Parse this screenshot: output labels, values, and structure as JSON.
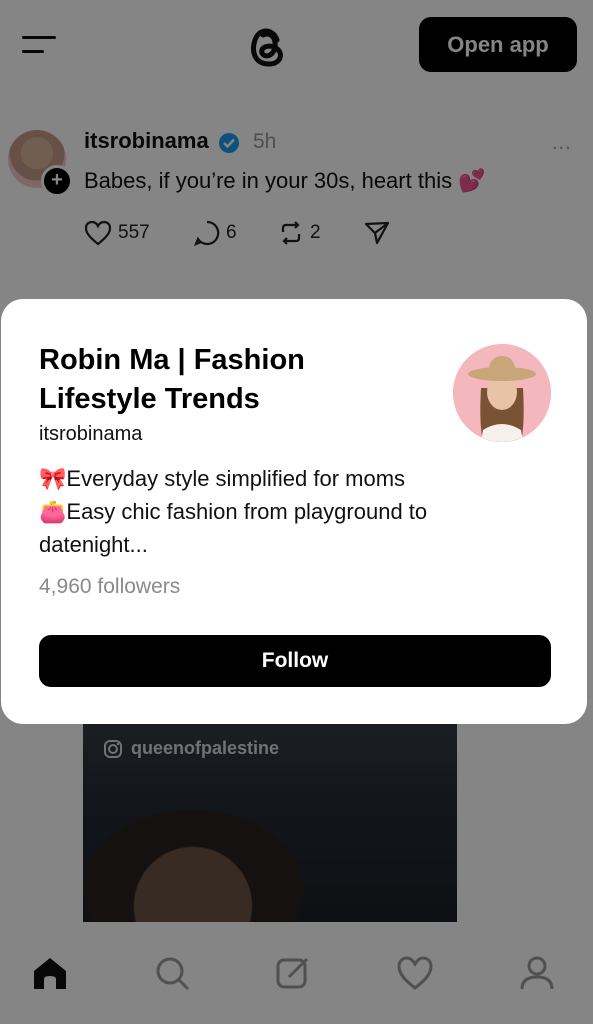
{
  "header": {
    "open_app_label": "Open app"
  },
  "post": {
    "username": "itsrobinama",
    "time": "5h",
    "more": "...",
    "text": "Babes, if you’re in your 30s, heart this 💕",
    "likes": "557",
    "comments": "6",
    "reposts": "2"
  },
  "media": {
    "watermark": "queenofpalestine"
  },
  "card": {
    "title": "Robin Ma | Fashion Lifestyle Trends",
    "handle": "itsrobinama",
    "bio_line1": "🎀Everyday style simplified for moms",
    "bio_line2": "👛Easy chic fashion from playground to",
    "bio_line3": "datenight...",
    "followers": "4,960 followers",
    "follow_label": "Follow"
  },
  "colors": {
    "verified": "#1d9bf0",
    "button_bg": "#000000",
    "overlay": "rgba(0,0,0,0.48)"
  },
  "icons": [
    "menu-icon",
    "threads-logo-icon",
    "plus-icon",
    "verified-icon",
    "more-icon",
    "heart-icon",
    "comment-icon",
    "repost-icon",
    "share-icon",
    "instagram-icon",
    "home-icon",
    "search-icon",
    "compose-icon",
    "activity-icon",
    "profile-icon"
  ]
}
